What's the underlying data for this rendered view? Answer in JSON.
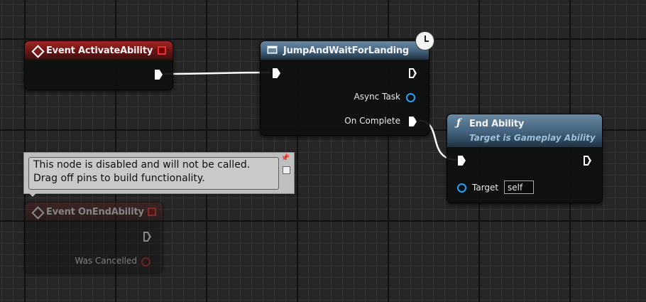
{
  "nodes": {
    "event_activate": {
      "title": "Event ActivateAbility"
    },
    "jump_wait": {
      "title": "JumpAndWaitForLanding",
      "pins": {
        "async_task": "Async Task",
        "on_complete": "On Complete"
      }
    },
    "end_ability": {
      "title": "End Ability",
      "subtitle": "Target is Gameplay Ability",
      "pins": {
        "target_label": "Target",
        "target_value": "self"
      }
    },
    "event_onend": {
      "title": "Event OnEndAbility",
      "pins": {
        "was_cancelled": "Was Cancelled"
      }
    }
  },
  "tooltip": {
    "line1": "This node is disabled and will not be called.",
    "line2": "Drag off pins to build functionality."
  },
  "colors": {
    "event_header": "#8a1f1f",
    "function_header": "#4a6a86",
    "object_pin": "#22a3ff",
    "delegate_pin": "#e63232",
    "exec_wire": "#ffffff"
  }
}
